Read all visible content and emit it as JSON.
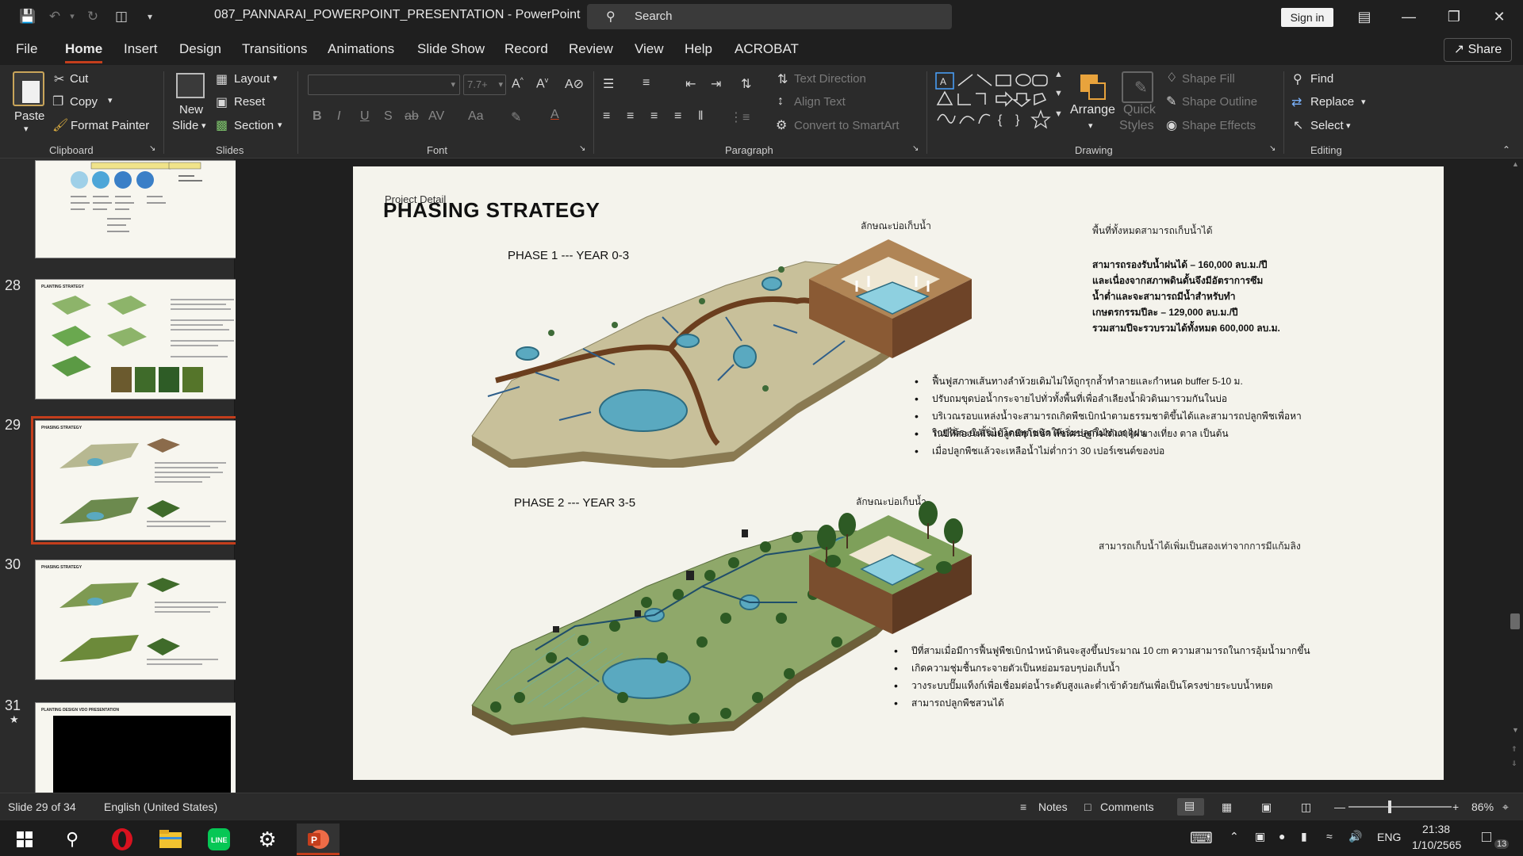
{
  "titlebar": {
    "doc_title": "087_PANNARAI_POWERPOINT_PRESENTATION  -  PowerPoint",
    "search_placeholder": "Search",
    "signin_label": "Sign in"
  },
  "menu": {
    "tabs": [
      "File",
      "Home",
      "Insert",
      "Design",
      "Transitions",
      "Animations",
      "Slide Show",
      "Record",
      "Review",
      "View",
      "Help",
      "ACROBAT"
    ],
    "active_tab": "Home",
    "share_label": "Share"
  },
  "ribbon": {
    "clipboard": {
      "paste": "Paste",
      "cut": "Cut",
      "copy": "Copy",
      "format_painter": "Format Painter",
      "group": "Clipboard"
    },
    "slides": {
      "new_slide_1": "New",
      "new_slide_2": "Slide",
      "layout": "Layout",
      "reset": "Reset",
      "section": "Section",
      "group": "Slides"
    },
    "font": {
      "size": "7.7+",
      "group": "Font"
    },
    "paragraph": {
      "text_direction": "Text Direction",
      "align_text": "Align Text",
      "convert_smartart": "Convert to SmartArt",
      "group": "Paragraph"
    },
    "drawing": {
      "arrange": "Arrange",
      "quick_styles_1": "Quick",
      "quick_styles_2": "Styles",
      "shape_fill": "Shape Fill",
      "shape_outline": "Shape Outline",
      "shape_effects": "Shape Effects",
      "group": "Drawing"
    },
    "editing": {
      "find": "Find",
      "replace": "Replace",
      "select": "Select",
      "group": "Editing"
    }
  },
  "thumbnails": [
    {
      "number": "",
      "title": ""
    },
    {
      "number": "28",
      "title": "PLANTING STRATEGY"
    },
    {
      "number": "29",
      "title": "PHASING STRATEGY"
    },
    {
      "number": "30",
      "title": "PHASING STRATEGY"
    },
    {
      "number": "31",
      "star": "★",
      "title": "PLANTING DESIGN VDO PRESENTATION"
    }
  ],
  "slide": {
    "project_detail": "Project Detail",
    "title": "PHASING STRATEGY",
    "phase1": {
      "label": "PHASE 1 --- YEAR 0-3",
      "pond_caption": "ลักษณะบ่อเก็บน้ำ",
      "capacity_caption": "พื้นที่ทั้งหมดสามารถเก็บน้ำได้",
      "capacity_lines": [
        "สามารถรองรับน้ำฝนได้ – 160,000 ลบ.ม./ปี",
        "และเนื่องจากสภาพดินดั้นจึงมีอัตราการซึม",
        "น้ำต่ำและจะสามารถมีน้ำสำหรับทำ",
        "เกษตรกรรมปีละ – 129,000 ลบ.ม./ปี",
        "รวมสามปีจะรวบรวมได้ทั้งหมด 600,000 ลบ.ม."
      ],
      "bullets": [
        "ฟื้นฟูสภาพเส้นทางลำห้วยเดิมไม่ให้ถูกรุกล้ำทำลายและกำหนด buffer 5-10 ม.",
        "ปรับถมขุดบ่อน้ำกระจายไปทั่วทั้งพื้นที่เพื่อลำเลียงน้ำผิวดินมารวมกันในบ่อ",
        "บริเวณรอบแหล่งน้ำจะสามารถเกิดพืชเบิกนำตามธรรมชาติขึ้นได้และสามารถปลูกพืชเพื่อหา",
        "รายได้ระยะสั้นได้โดยทุกชนิดให้เริ่มปลูกในช่วงฤดูฝน",
        "ในปีที่สองให้เริ่มปลูกพืชโตช้า พืชเศรษฐกิจได้แก่ ไผ่ ยางเที่ยง ตาล เป็นต้น",
        "เมื่อปลูกพืชแล้วจะเหลือน้ำไม่ต่ำกว่า 30 เปอร์เซนต์ของบ่อ"
      ]
    },
    "phase2": {
      "label": "PHASE 2 --- YEAR 3-5",
      "pond_caption": "ลักษณะบ่อเก็บน้ำ",
      "capacity_caption": "สามารถเก็บน้ำได้เพิ่มเป็นสองเท่าจากการมีแก้มลิง",
      "bullets": [
        "ปีที่สามเมื่อมีการฟื้นฟูพืชเบิกนำหน้าดินจะสูงขึ้นประมาณ 10 cm ความสามารถในการอุ้มน้ำมากขึ้น",
        "เกิดความชุ่มชื้นกระจายตัวเป็นหย่อมรอบๆบ่อเก็บน้ำ",
        "วางระบบปั๊มแท็งก์เพื่อเชื่อมต่อน้ำระดับสูงและต่ำเข้าด้วยกันเพื่อเป็นโครงข่ายระบบน้ำหยด",
        "สามารถปลูกพืชสวนได้"
      ]
    }
  },
  "statusbar": {
    "slide_info": "Slide 29 of 34",
    "language": "English (United States)",
    "notes": "Notes",
    "comments": "Comments",
    "zoom": "86%"
  },
  "taskbar": {
    "lang": "ENG",
    "time": "21:38",
    "date": "1/10/2565",
    "notif_count": "13"
  },
  "colors": {
    "accent": "#c43e1c",
    "water": "#5aa9c0",
    "land": "#c9c4a8",
    "vegetation": "#2e6b2a"
  }
}
